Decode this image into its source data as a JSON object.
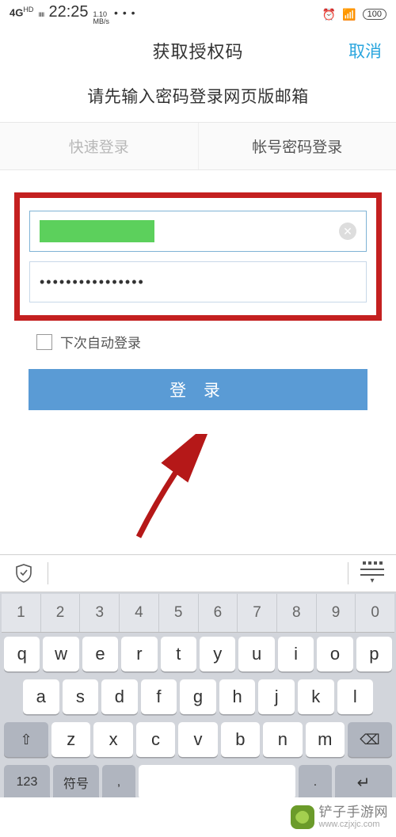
{
  "status": {
    "signal": "4G",
    "hd": "HD",
    "bars": "ıııı",
    "time": "22:25",
    "speed_top": "1.10",
    "speed_unit": "MB/s",
    "dots": "• • •",
    "battery": "100"
  },
  "nav": {
    "title": "获取授权码",
    "cancel": "取消"
  },
  "instruction": "请先输入密码登录网页版邮箱",
  "tabs": {
    "quick": "快速登录",
    "account": "帐号密码登录"
  },
  "form": {
    "password_display": "••••••••••••••••",
    "remember_label": "下次自动登录",
    "login_button": "登 录"
  },
  "keyboard": {
    "nums": [
      "1",
      "2",
      "3",
      "4",
      "5",
      "6",
      "7",
      "8",
      "9",
      "0"
    ],
    "row1": [
      "q",
      "w",
      "e",
      "r",
      "t",
      "y",
      "u",
      "i",
      "o",
      "p"
    ],
    "row2": [
      "a",
      "s",
      "d",
      "f",
      "g",
      "h",
      "j",
      "k",
      "l"
    ],
    "row3": [
      "z",
      "x",
      "c",
      "v",
      "b",
      "n",
      "m"
    ],
    "shift": "⇧",
    "backspace": "⌫",
    "num_toggle": "123",
    "symbol": "符号",
    "comma": ",",
    "period": ".",
    "enter": "↵"
  },
  "watermark": {
    "name": "铲子手游网",
    "url": "www.czjxjc.com"
  }
}
